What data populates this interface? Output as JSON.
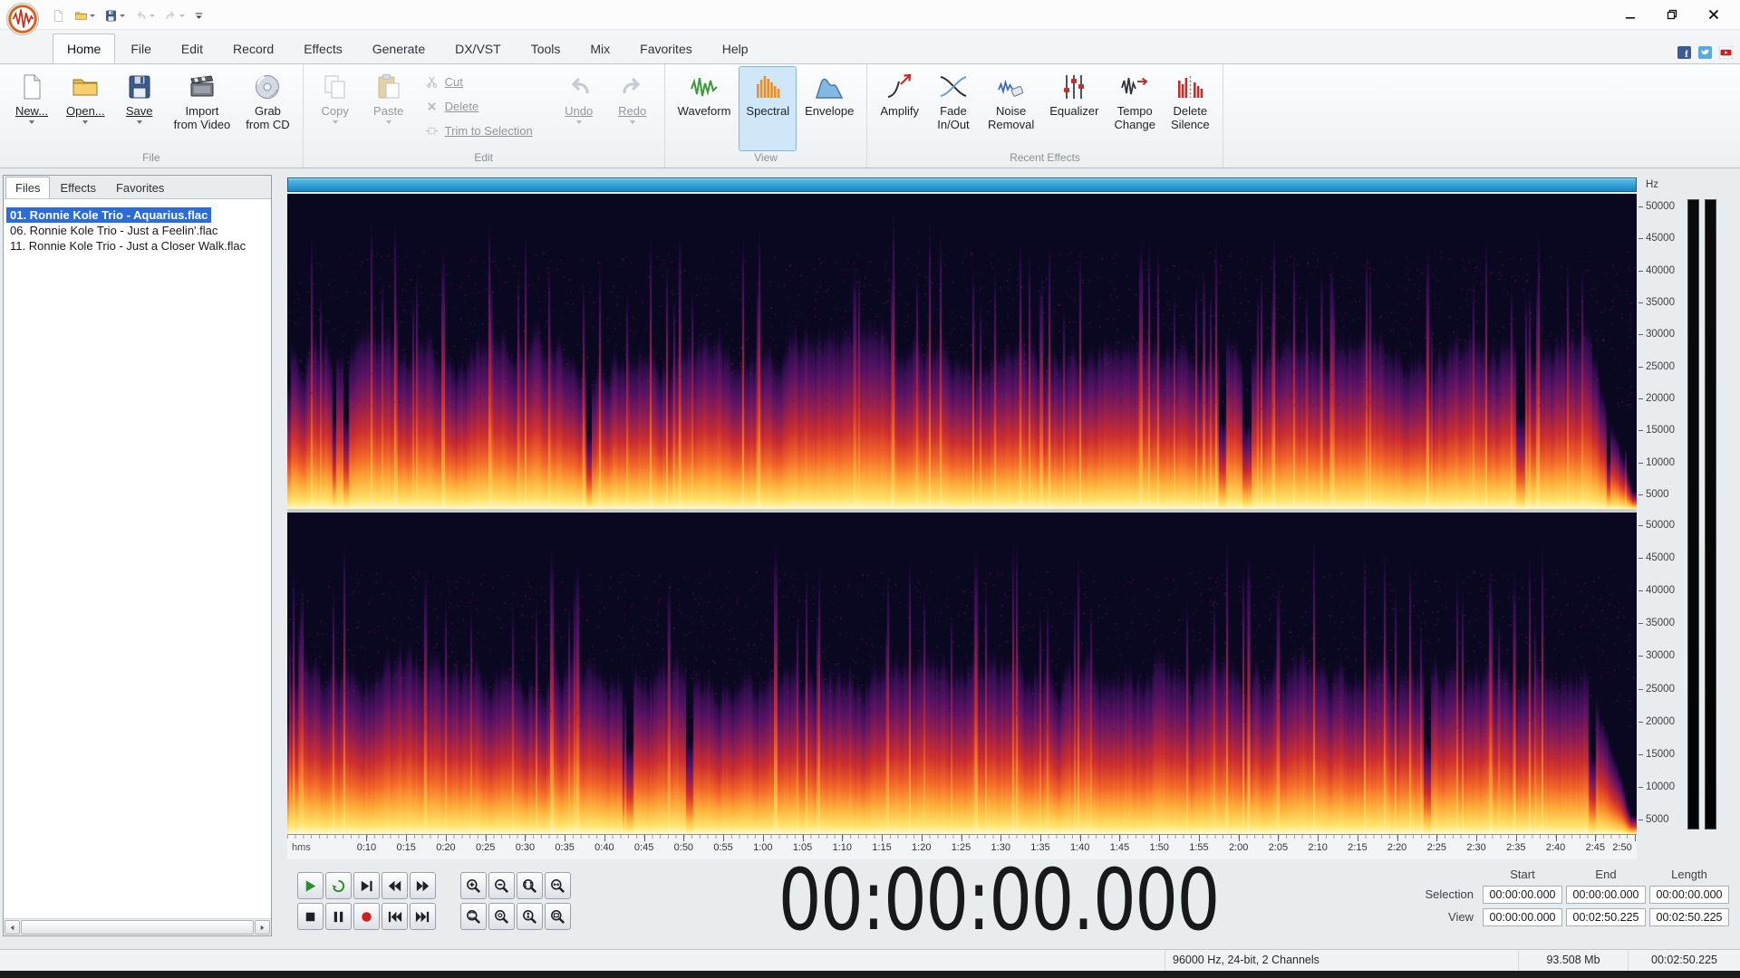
{
  "titlebar": {
    "app_logo": "audio-wave-logo",
    "quick_access": [
      {
        "icon": "new-file",
        "name": "new-document"
      },
      {
        "icon": "open-folder",
        "name": "open",
        "dropdown": true
      },
      {
        "icon": "save",
        "name": "save",
        "dropdown": true
      },
      {
        "icon": "undo",
        "name": "undo",
        "dropdown": true,
        "disabled": true
      },
      {
        "icon": "redo",
        "name": "redo",
        "dropdown": true,
        "disabled": true
      },
      {
        "icon": "customize",
        "name": "customize-quick-access",
        "dropdown": true
      }
    ],
    "window_controls": [
      "minimize",
      "maximize",
      "close"
    ]
  },
  "ribbon": {
    "tabs": [
      {
        "label": "Home",
        "active": true
      },
      {
        "label": "File"
      },
      {
        "label": "Edit"
      },
      {
        "label": "Record"
      },
      {
        "label": "Effects"
      },
      {
        "label": "Generate"
      },
      {
        "label": "DX/VST"
      },
      {
        "label": "Tools"
      },
      {
        "label": "Mix"
      },
      {
        "label": "Favorites"
      },
      {
        "label": "Help"
      }
    ],
    "social": [
      "facebook",
      "twitter",
      "youtube"
    ],
    "groups": [
      {
        "label": "File",
        "items": [
          {
            "type": "large",
            "label": "New...",
            "icon": "new-file",
            "dropdown": true,
            "underline": true
          },
          {
            "type": "large",
            "label": "Open...",
            "icon": "open-folder",
            "dropdown": true,
            "underline": true
          },
          {
            "type": "large",
            "label": "Save",
            "icon": "save",
            "dropdown": true,
            "underline": true
          },
          {
            "type": "large",
            "label": "Import\nfrom Video",
            "icon": "import-video"
          },
          {
            "type": "large",
            "label": "Grab\nfrom CD",
            "icon": "grab-cd"
          }
        ]
      },
      {
        "label": "Edit",
        "items": [
          {
            "type": "large",
            "label": "Copy",
            "icon": "copy",
            "dropdown": true,
            "disabled": true
          },
          {
            "type": "large",
            "label": "Paste",
            "icon": "paste",
            "dropdown": true,
            "disabled": true
          },
          {
            "type": "stack",
            "items": [
              {
                "label": "Cut",
                "icon": "cut",
                "disabled": true,
                "underline": true
              },
              {
                "label": "Delete",
                "icon": "delete",
                "disabled": true,
                "underline": true
              },
              {
                "label": "Trim to Selection",
                "icon": "trim",
                "disabled": true,
                "underline": true
              }
            ]
          },
          {
            "type": "large",
            "label": "Undo",
            "icon": "undo",
            "dropdown": true,
            "disabled": true,
            "underline": true
          },
          {
            "type": "large",
            "label": "Redo",
            "icon": "redo",
            "dropdown": true,
            "disabled": true,
            "underline": true
          }
        ]
      },
      {
        "label": "View",
        "items": [
          {
            "type": "large",
            "label": "Waveform",
            "icon": "waveform"
          },
          {
            "type": "large",
            "label": "Spectral",
            "icon": "spectral",
            "active": true
          },
          {
            "type": "large",
            "label": "Envelope",
            "icon": "envelope"
          }
        ]
      },
      {
        "label": "Recent Effects",
        "items": [
          {
            "type": "large",
            "label": "Amplify",
            "icon": "amplify"
          },
          {
            "type": "large",
            "label": "Fade\nIn/Out",
            "icon": "fade"
          },
          {
            "type": "large",
            "label": "Noise\nRemoval",
            "icon": "noise-removal"
          },
          {
            "type": "large",
            "label": "Equalizer",
            "icon": "equalizer"
          },
          {
            "type": "large",
            "label": "Tempo\nChange",
            "icon": "tempo"
          },
          {
            "type": "large",
            "label": "Delete\nSilence",
            "icon": "delete-silence"
          }
        ]
      }
    ]
  },
  "sidebar": {
    "tabs": [
      {
        "label": "Files",
        "active": true
      },
      {
        "label": "Effects"
      },
      {
        "label": "Favorites"
      }
    ],
    "files": [
      {
        "name": "01. Ronnie Kole Trio - Aquarius.flac",
        "selected": true
      },
      {
        "name": "06. Ronnie Kole Trio - Just a Feelin'.flac"
      },
      {
        "name": "11. Ronnie Kole Trio - Just a Closer Walk.flac"
      }
    ]
  },
  "editor": {
    "freq_unit": "Hz",
    "freq_labels": [
      "50000",
      "45000",
      "40000",
      "35000",
      "30000",
      "25000",
      "20000",
      "15000",
      "10000",
      "5000"
    ],
    "time_ruler": {
      "unit_label": "hms",
      "labels": [
        "0:10",
        "0:15",
        "0:20",
        "0:25",
        "0:30",
        "0:35",
        "0:40",
        "0:45",
        "0:50",
        "0:55",
        "1:00",
        "1:05",
        "1:10",
        "1:15",
        "1:20",
        "1:25",
        "1:30",
        "1:35",
        "1:40",
        "1:45",
        "1:50",
        "1:55",
        "2:00",
        "2:05",
        "2:10",
        "2:15",
        "2:20",
        "2:25",
        "2:30",
        "2:35",
        "2:40",
        "2:45",
        "2:50"
      ]
    },
    "view_duration_seconds": 170.225,
    "channels": 2
  },
  "transport": {
    "row1": [
      "play",
      "loop",
      "play-all",
      "rewind",
      "forward"
    ],
    "zoom_row1": [
      "zoom-in",
      "zoom-out",
      "zoom-selection",
      "zoom-full"
    ],
    "row2": [
      "stop",
      "pause",
      "record",
      "go-start",
      "go-end"
    ],
    "zoom_row2": [
      "zoom-vert-selection",
      "zoom-vert-out",
      "zoom-vert-full",
      "zoom-vert-fit"
    ]
  },
  "time_display": "00:00:00.000",
  "selection_panel": {
    "headers": [
      "Start",
      "End",
      "Length"
    ],
    "rows": [
      {
        "label": "Selection",
        "values": [
          "00:00:00.000",
          "00:00:00.000",
          "00:00:00.000"
        ]
      },
      {
        "label": "View",
        "values": [
          "00:00:00.000",
          "00:02:50.225",
          "00:02:50.225"
        ]
      }
    ]
  },
  "status_bar": {
    "format": "96000 Hz, 24-bit, 2 Channels",
    "size": "93.508 Mb",
    "length": "00:02:50.225"
  }
}
